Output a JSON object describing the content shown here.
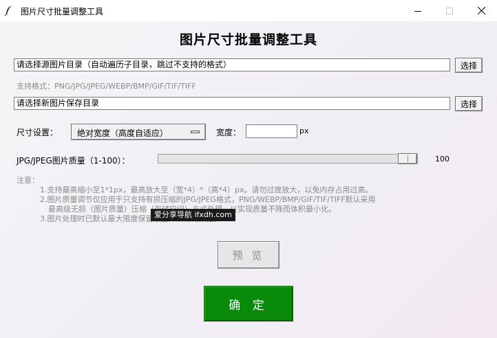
{
  "window": {
    "title": "图片尺寸批量调整工具",
    "icon": "feather-icon",
    "controls": [
      "minimize-icon",
      "maximize-icon",
      "close-icon"
    ]
  },
  "main_title": "图片尺寸批量调整工具",
  "source": {
    "value": "请选择源图片目录（自动遍历子目录，跳过不支持的格式）",
    "button": "选择"
  },
  "formats_text": "支持格式：PNG/JPG/JPEG/WEBP/BMP/GIF/TIF/TIFF",
  "dest": {
    "value": "请选择新图片保存目录",
    "button": "选择"
  },
  "size": {
    "label": "尺寸设置：",
    "mode": "绝对宽度（高度自适应）",
    "width_label": "宽度：",
    "width_value": "",
    "unit": "px"
  },
  "quality": {
    "label": "JPG/JPEG图片质量（1-100）：",
    "value": "100",
    "min": 1,
    "max": 100,
    "current": 100
  },
  "notes": {
    "title": "注意：",
    "lines": [
      "1.支持最高缩小至1*1px，最高放大至（宽*4）*（高*4）px。请勿过度放大，以免内存占用过高。",
      "2.图片质量调节仅应用于只支持有损压缩的JPG/JPEG格式，PNG/WEBP/BMP/GIF/TIF/TIFF默认采用",
      "最高级无损（图片质量）压缩（存储空间）方式处理，以实现质量不降而体积最小化。",
      "3.图片处理时已默认最大限度保留原图片所有元数据。"
    ]
  },
  "watermark": "爱分享导航 ifxdh.com",
  "buttons": {
    "preview": "预 览",
    "confirm": "确 定"
  },
  "colors": {
    "confirm_bg": "#0a8a0a",
    "preview_text": "#8c8c8c",
    "hint_text": "#8a8a8a"
  }
}
